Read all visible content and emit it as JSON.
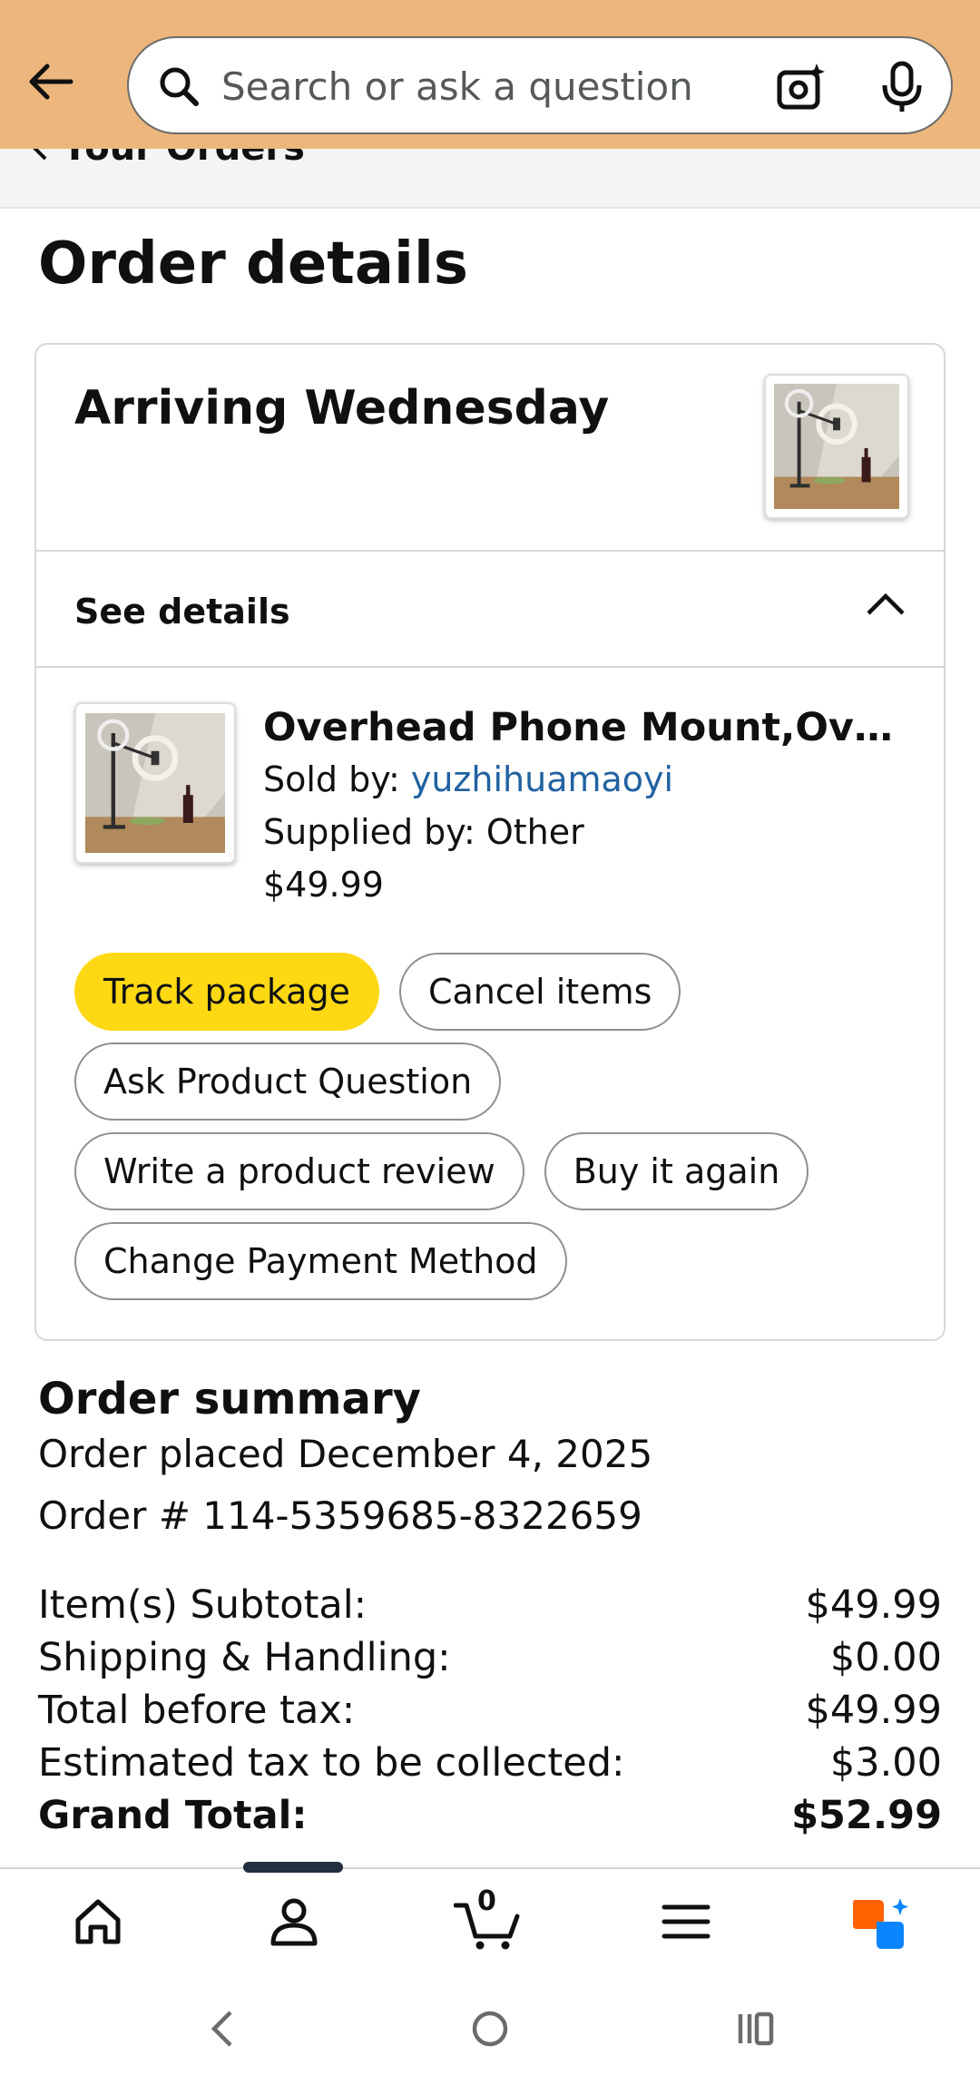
{
  "header": {
    "search_placeholder": "Search or ask a question"
  },
  "breadcrumb": "Your Orders",
  "page_title": "Order details",
  "shipment": {
    "status": "Arriving Wednesday",
    "see_details_label": "See details"
  },
  "item": {
    "title": "Overhead Phone Mount,Overhead Phone Mount",
    "sold_by_prefix": "Sold by: ",
    "seller": "yuzhihuamaoyi",
    "supplied_by": "Supplied by: Other",
    "price": "$49.99"
  },
  "actions": {
    "track": "Track package",
    "cancel": "Cancel items",
    "ask": "Ask Product Question",
    "review": "Write a product review",
    "buy_again": "Buy it again",
    "payment": "Change Payment Method"
  },
  "summary": {
    "title": "Order summary",
    "placed": "Order placed December 4, 2025",
    "order_number": "Order # 114-5359685-8322659",
    "rows": [
      {
        "label": "Item(s) Subtotal:",
        "value": "$49.99"
      },
      {
        "label": "Shipping & Handling:",
        "value": "$0.00"
      },
      {
        "label": "Total before tax:",
        "value": "$49.99"
      },
      {
        "label": "Estimated tax to be collected:",
        "value": "$3.00"
      },
      {
        "label": "Grand Total:",
        "value": "$52.99"
      }
    ]
  },
  "bottom_nav": {
    "cart_count": "0"
  },
  "icons": {
    "back": "arrow-left-icon",
    "search": "search-icon",
    "camera": "camera-sparkle-icon",
    "mic": "microphone-icon",
    "home": "home-icon",
    "account": "person-icon",
    "cart": "cart-icon",
    "menu": "hamburger-icon",
    "rufus": "rufus-chat-icon"
  },
  "colors": {
    "header_bg": "#ecb67c",
    "primary_button": "#ffd814",
    "link": "#2162a1",
    "rufus_orange": "#ff6200",
    "rufus_blue": "#0a84ff"
  }
}
